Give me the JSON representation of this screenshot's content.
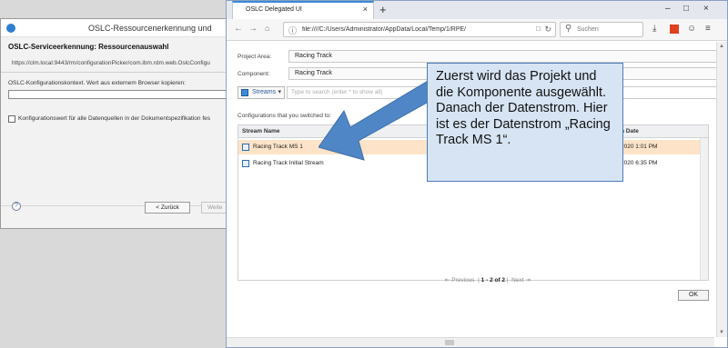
{
  "left_dialog": {
    "title": "OSLC-Ressourcenerkennung und",
    "section_heading": "OSLC-Serviceerkennung: Ressourcenauswahl",
    "url": "https://clm.local:9443/rm/configurationPicker/com.ibm.rdm.web.OslcConfigu",
    "context_label": "OSLC-Konfigurationskontext. Wert aus externem Browser kopieren:",
    "context_value": "",
    "checkbox_label": "Konfigurationswert für alle Datenquellen in der Dokumentspezifikation fes",
    "help_label": "?",
    "back_button": "< Zurück",
    "next_button": "Weite"
  },
  "browser": {
    "tab_title": "OSLC Delegated UI",
    "tab_close": "×",
    "new_tab": "+",
    "window_controls": [
      "–",
      "□",
      "×"
    ],
    "url": "file:////C:/Users/Administrator/AppData/Local/Temp/1/RPE/",
    "search_placeholder": "Suchen"
  },
  "page": {
    "project_area_label": "Project Area:",
    "project_area_value": "Racing Track",
    "component_label": "Component:",
    "component_value": "Racing Track",
    "streams_button": "Streams",
    "filter_placeholder": "Type to search (enter * to show all)",
    "configurations_heading": "Configurations that you switched to:",
    "columns": [
      "Stream Name",
      "n Date"
    ],
    "rows": [
      {
        "name": "Racing Track MS 1",
        "date": "2020 1:01 PM",
        "selected": true
      },
      {
        "name": "Racing Track Initial Stream",
        "date": "2020 6:35 PM",
        "selected": false
      }
    ],
    "pager": {
      "previous": "Previous",
      "range": "1 - 2 of 2",
      "next": "Next"
    },
    "ok_button": "OK"
  },
  "callout": {
    "text": "Zuerst wird das Projekt und die Komponente ausgewählt. Danach der Datenstrom. Hier ist es der Datenstrom „Racing Track MS 1“."
  },
  "colors": {
    "selected_row": "#fde4c8",
    "callout_bg": "#d7e4f3",
    "arrow": "#4f86c6"
  }
}
